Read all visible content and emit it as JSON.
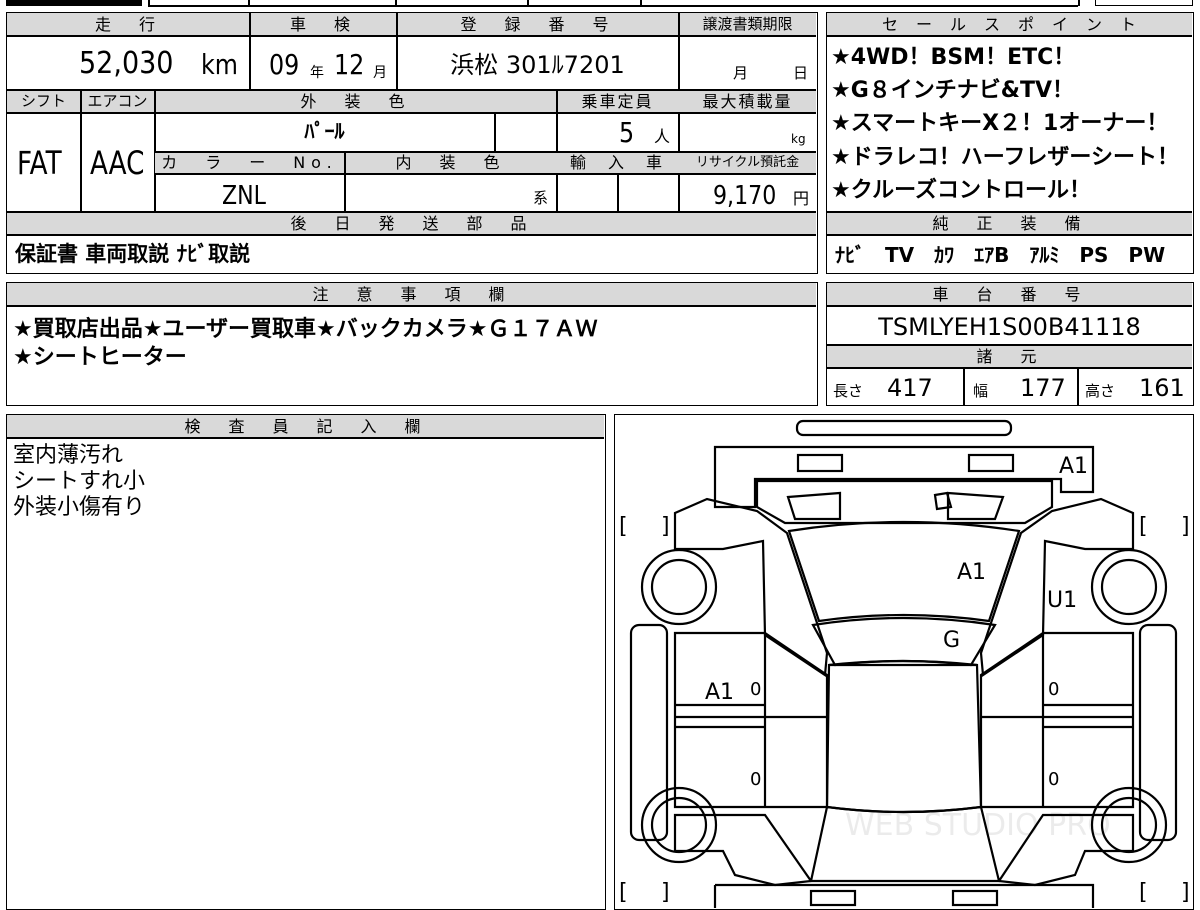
{
  "headers": {
    "mileage": "走　行",
    "inspection": "車　検",
    "registration": "登　録　番　号",
    "transfer_deadline": "譲渡書類期限",
    "shift": "シフト",
    "aircon": "エアコン",
    "exterior_color": "外　装　色",
    "capacity": "乗車定員",
    "max_load": "最大積載量",
    "color_no": "カ　ラ　ー　No.",
    "interior_color": "内　装　色",
    "import": "輸　入　車",
    "recycle": "リサイクル預託金",
    "later_parts": "後　日　発　送　部　品",
    "sales_points": "セ　ー　ル　ス　ポ　イ　ン　ト",
    "genuine_equipment": "純　正　装　備",
    "notes": "注　意　事　項　欄",
    "chassis_no": "車　台　番　号",
    "specs": "諸　元",
    "inspector": "検　査　員　記　入　欄"
  },
  "vehicle": {
    "mileage": "52,030",
    "mileage_unit": "km",
    "inspection_year": "09",
    "year_unit": "年",
    "inspection_month": "12",
    "month_unit": "月",
    "plate": "浜松 301ﾙ7201",
    "deadline_month_unit": "月",
    "deadline_day_unit": "日",
    "shift": "FAT",
    "aircon": "AAC",
    "exterior_color": "ﾊﾟｰﾙ",
    "capacity": "5",
    "capacity_unit": "人",
    "max_load_unit": "kg",
    "color_no": "ZNL",
    "interior_suffix": "系",
    "recycle": "9,170",
    "recycle_unit": "円",
    "later_parts": "保証書 車両取説 ﾅﾋﾞ取説"
  },
  "sales_points": [
    "★4WD！BSM！ETC！",
    "★G８インチナビ&TV！",
    "★スマートキーX２！1オーナー！",
    "★ドラレコ！ハーフレザーシート！",
    "★クルーズコントロール！"
  ],
  "genuine_equipment": "ﾅﾋﾞ　TV　ｶﾜ　ｴｱB　ｱﾙﾐ　PS　PW",
  "notes": [
    "★買取店出品★ユーザー買取車★バックカメラ★Ｇ１７ＡＷ",
    "★シートヒーター"
  ],
  "chassis_no": "TSMLYEH1S00B41118",
  "specs": {
    "length_label": "長さ",
    "length": "417",
    "width_label": "幅",
    "width": "177",
    "height_label": "高さ",
    "height": "161"
  },
  "inspector_notes": [
    "室内薄汚れ",
    "シートすれ小",
    "外装小傷有り"
  ],
  "diagram": {
    "marks": {
      "front_bumper": "A1",
      "hood": "A1",
      "windshield": "G",
      "right_front_fender": "U1",
      "left_front_door": "A1",
      "left_front_door_zero": "0",
      "left_rear_door_zero": "0",
      "right_front_door_zero": "0",
      "right_rear_door_zero": "0"
    },
    "bracket_open": "[",
    "bracket_close": "]",
    "watermark": "WEB STUDIO PRO"
  },
  "colors": {
    "border": "#000000",
    "header_bg": "#d9d9d9",
    "background": "#ffffff"
  }
}
